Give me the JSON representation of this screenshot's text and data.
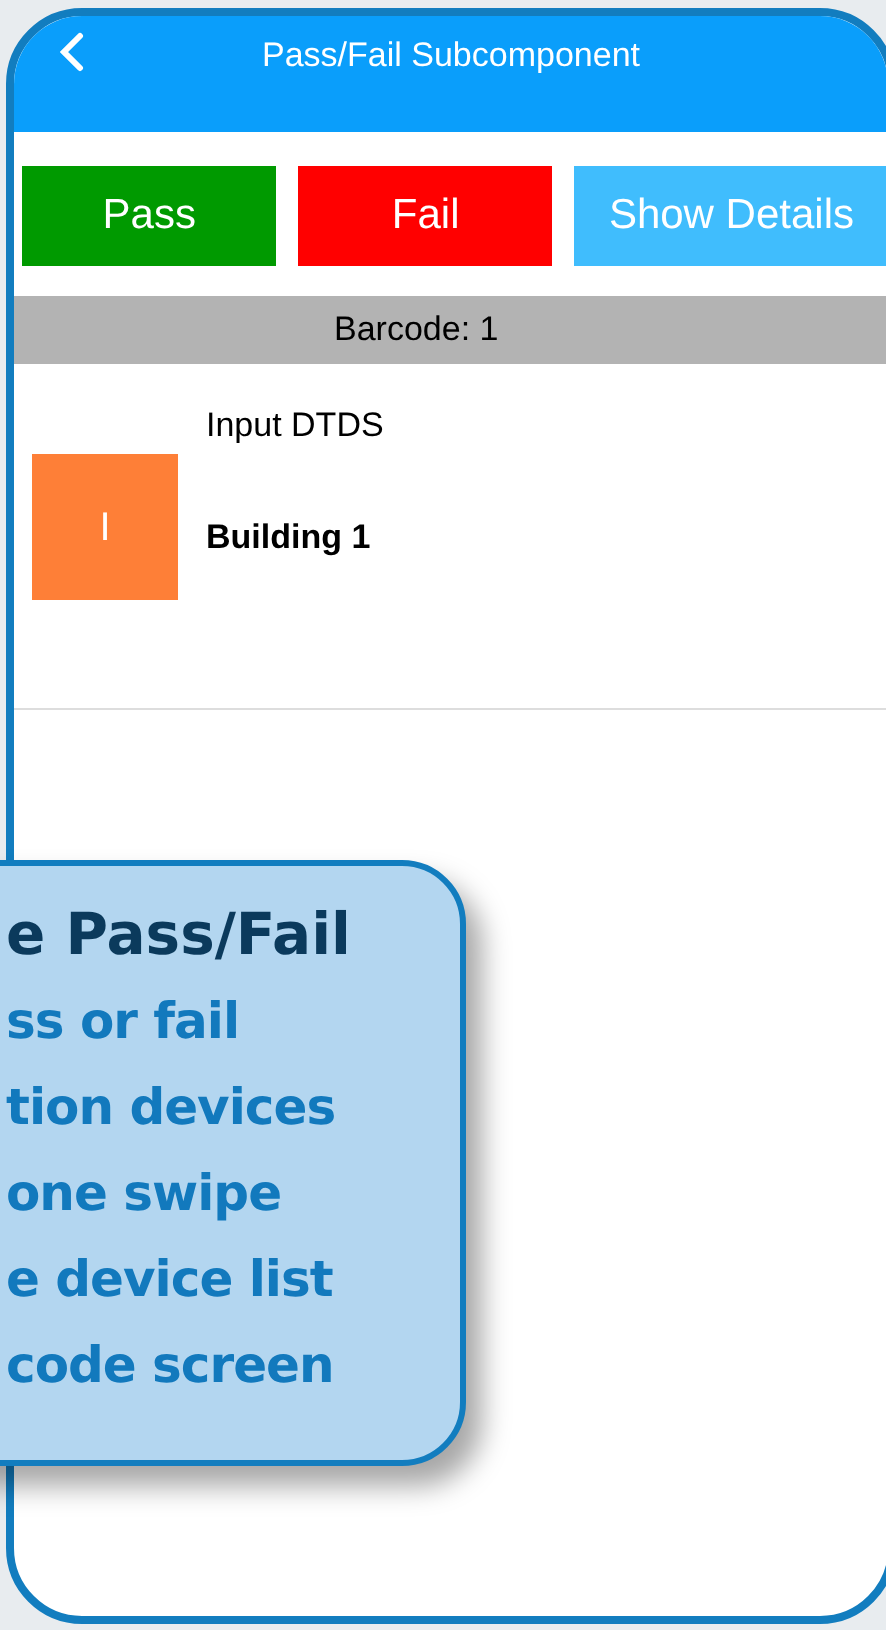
{
  "header": {
    "title": "Pass/Fail Subcomponent"
  },
  "actions": [
    {
      "label": "Pass",
      "kind": "pass"
    },
    {
      "label": "Fail",
      "kind": "fail"
    },
    {
      "label": "Show Details",
      "kind": "details"
    }
  ],
  "barcode_bar": {
    "text": "Barcode: 1"
  },
  "devices": [
    {
      "type": "Input DTDS",
      "icon_letter": "I",
      "color": "#fe7f37",
      "location": "Building 1"
    }
  ],
  "callout": {
    "title": "e Pass/Fail",
    "lines": [
      "ss or fail",
      "tion devices",
      "one swipe",
      "e device list",
      "code screen"
    ]
  }
}
